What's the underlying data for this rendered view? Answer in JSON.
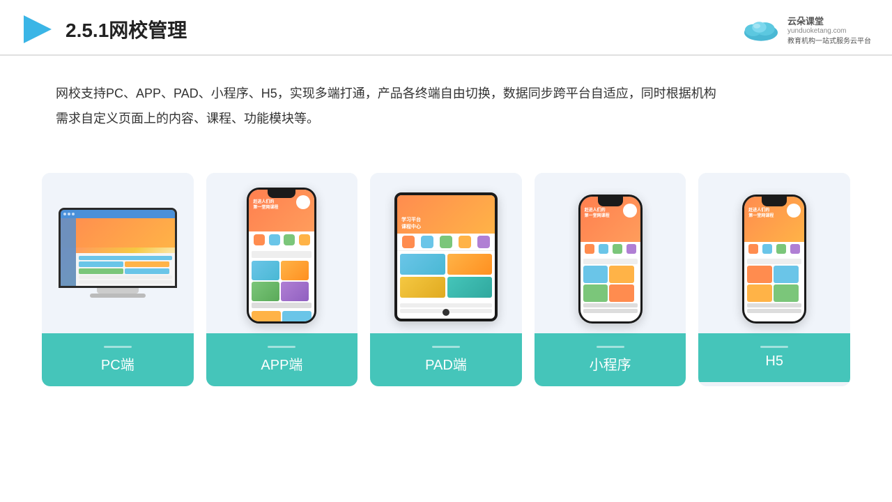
{
  "header": {
    "title": "2.5.1网校管理",
    "logo_name": "云朵课堂",
    "logo_url": "yunduoketang.com",
    "logo_slogan": "教育机构一站\n式服务云平台"
  },
  "description": {
    "text": "网校支持PC、APP、PAD、小程序、H5，实现多端打通，产品各终端自由切换，数据同步跨平台自适应，同时根据机构\n需求自定义页面上的内容、课程、功能模块等。"
  },
  "cards": [
    {
      "id": "pc",
      "label": "PC端"
    },
    {
      "id": "app",
      "label": "APP端"
    },
    {
      "id": "pad",
      "label": "PAD端"
    },
    {
      "id": "miniprogram",
      "label": "小程序"
    },
    {
      "id": "h5",
      "label": "H5"
    }
  ],
  "colors": {
    "accent": "#45c5ba",
    "header_border": "#e0e0e0",
    "card_bg": "#eef2f8",
    "text_dark": "#222222",
    "text_body": "#333333"
  }
}
